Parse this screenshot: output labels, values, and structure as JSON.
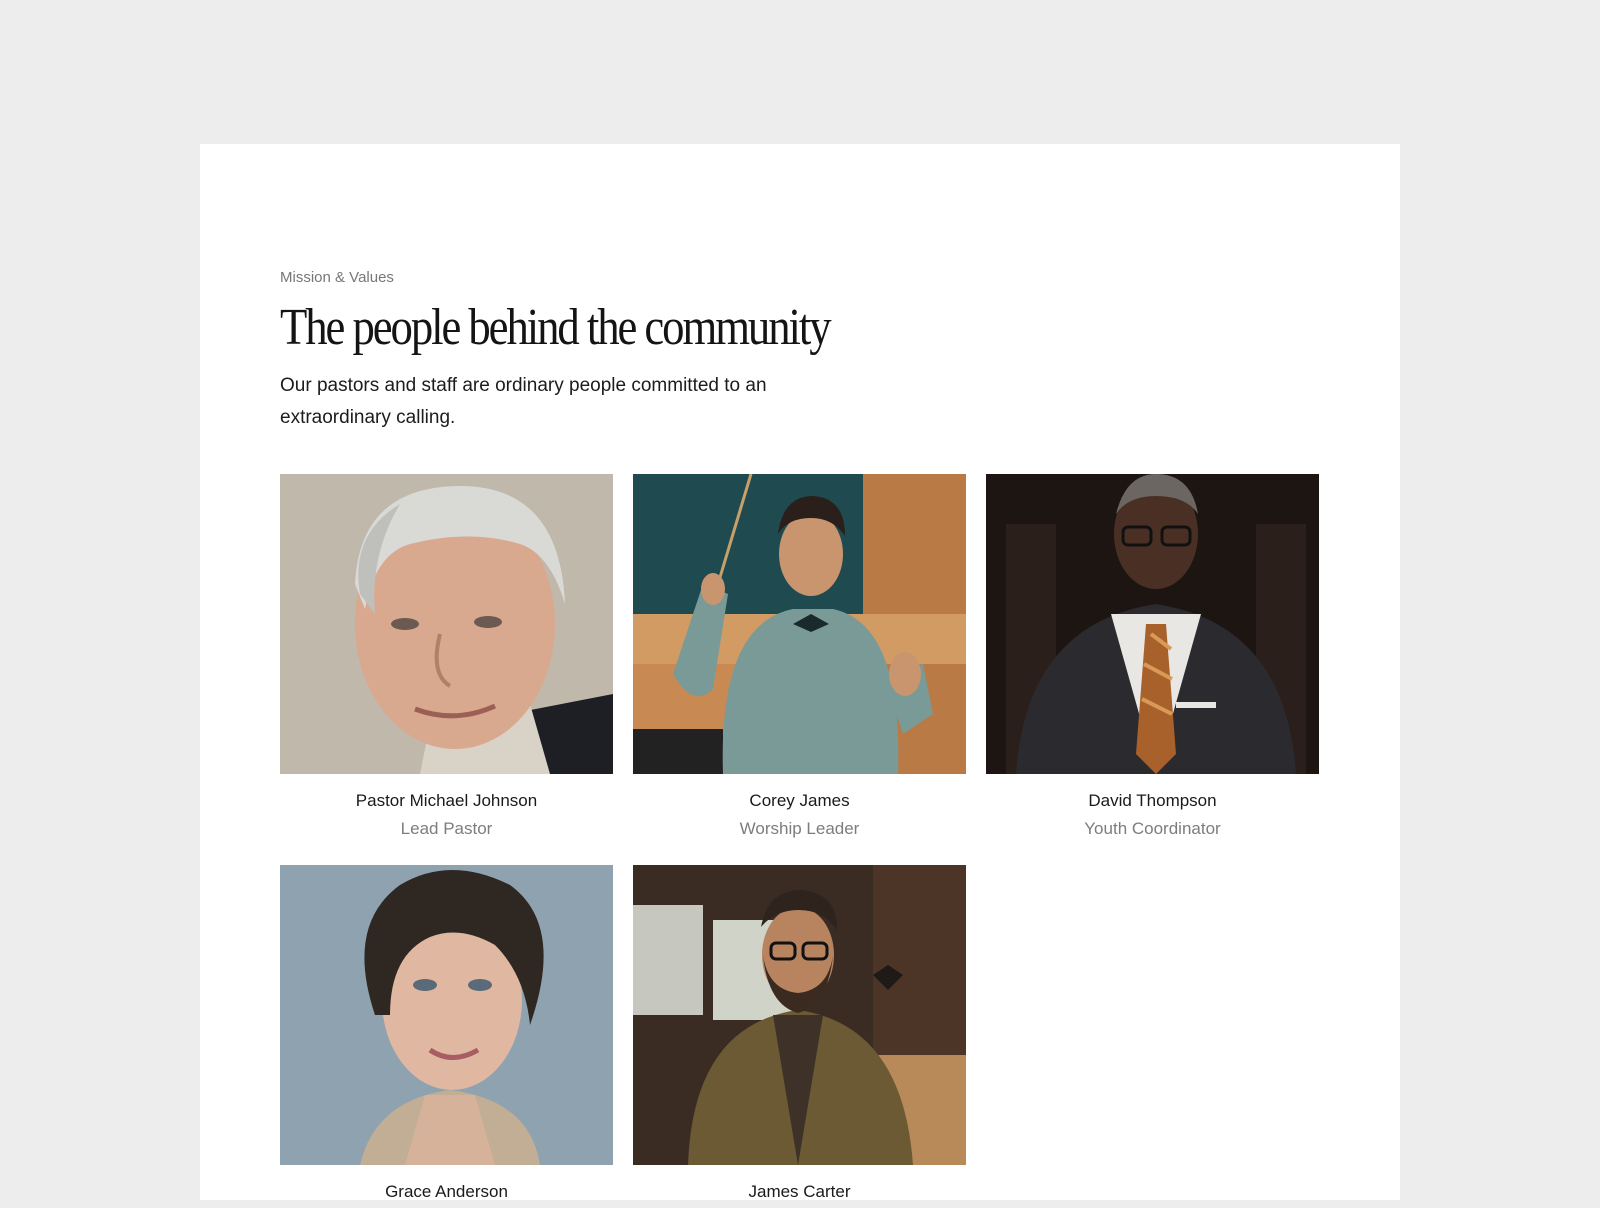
{
  "section": {
    "eyebrow": "Mission & Values",
    "title": "The people behind the community",
    "description": "Our pastors and staff are ordinary people committed to an extraordinary calling."
  },
  "team": [
    {
      "name": "Pastor Michael Johnson",
      "role": "Lead Pastor",
      "photo_icon": "portrait-photo-icon"
    },
    {
      "name": "Corey James",
      "role": "Worship Leader",
      "photo_icon": "portrait-photo-icon"
    },
    {
      "name": "David Thompson",
      "role": "Youth Coordinator",
      "photo_icon": "portrait-photo-icon"
    },
    {
      "name": "Grace Anderson",
      "role": "",
      "photo_icon": "portrait-photo-icon"
    },
    {
      "name": "James Carter",
      "role": "",
      "photo_icon": "portrait-photo-icon"
    }
  ],
  "colors": {
    "page_background": "#ededed",
    "card_background": "#ffffff",
    "heading_text": "#141414",
    "muted_text": "#7d7d7d"
  }
}
